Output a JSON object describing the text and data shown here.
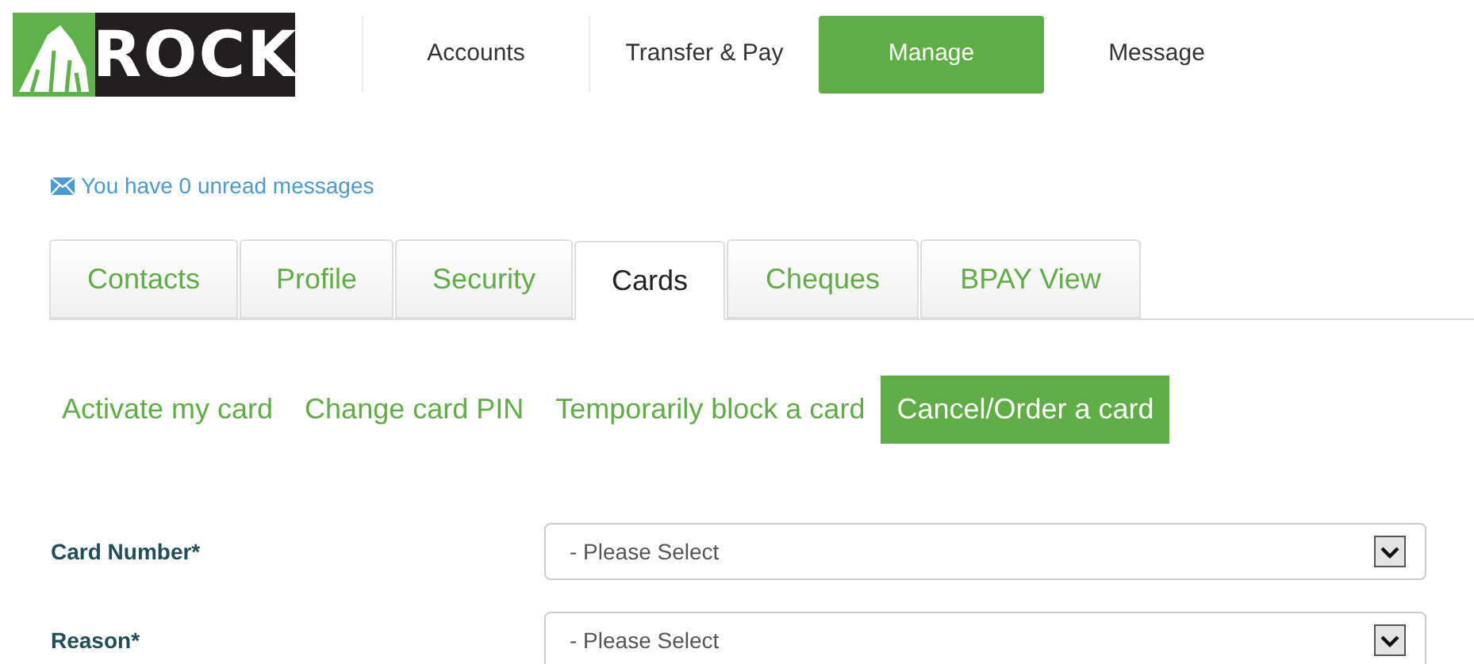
{
  "logo": {
    "text": "ROCK"
  },
  "nav": [
    {
      "label": "Accounts",
      "selected": false
    },
    {
      "label": "Transfer & Pay",
      "selected": false
    },
    {
      "label": "Manage",
      "selected": true
    },
    {
      "label": "Message",
      "selected": false
    }
  ],
  "messages_link": "You have 0 unread messages",
  "tabs": [
    {
      "label": "Contacts",
      "selected": false
    },
    {
      "label": "Profile",
      "selected": false
    },
    {
      "label": "Security",
      "selected": false
    },
    {
      "label": "Cards",
      "selected": true
    },
    {
      "label": "Cheques",
      "selected": false
    },
    {
      "label": "BPAY View",
      "selected": false
    }
  ],
  "subnav": [
    {
      "label": "Activate my card",
      "selected": false
    },
    {
      "label": "Change card PIN",
      "selected": false
    },
    {
      "label": "Temporarily block a card",
      "selected": false
    },
    {
      "label": "Cancel/Order a card",
      "selected": true
    }
  ],
  "form": [
    {
      "label": "Card Number*",
      "value": "- Please Select"
    },
    {
      "label": "Reason*",
      "value": "- Please Select"
    }
  ]
}
